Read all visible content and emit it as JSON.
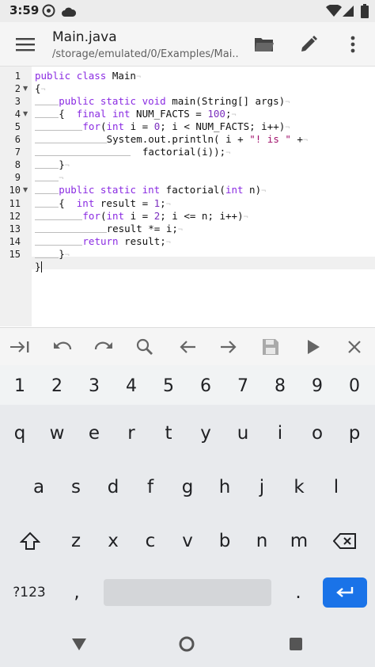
{
  "status_bar": {
    "time": "3:59"
  },
  "app_bar": {
    "title": "Main.java",
    "subtitle": "/storage/emulated/0/Examples/Mai..."
  },
  "editor": {
    "line_numbers": [
      "1",
      "2",
      "3",
      "4",
      "5",
      "6",
      "7",
      "8",
      "9",
      "10",
      "11",
      "12",
      "13",
      "14",
      "15"
    ],
    "folded_lines": [
      "2",
      "4",
      "10"
    ],
    "lines": [
      [
        {
          "t": "kw",
          "v": "public"
        },
        {
          "t": "p",
          "v": " "
        },
        {
          "t": "kw",
          "v": "class"
        },
        {
          "t": "p",
          "v": " Main"
        }
      ],
      [
        {
          "t": "p",
          "v": "{"
        }
      ],
      [
        {
          "t": "i",
          "n": 2
        },
        {
          "t": "kw",
          "v": "public"
        },
        {
          "t": "p",
          "v": " "
        },
        {
          "t": "kw",
          "v": "static"
        },
        {
          "t": "p",
          "v": " "
        },
        {
          "t": "kw",
          "v": "void"
        },
        {
          "t": "p",
          "v": " main(String[] args)"
        }
      ],
      [
        {
          "t": "i",
          "n": 2
        },
        {
          "t": "p",
          "v": "{"
        },
        {
          "t": "kw",
          "v": "  final"
        },
        {
          "t": "p",
          "v": " "
        },
        {
          "t": "kw",
          "v": "int"
        },
        {
          "t": "p",
          "v": " NUM_FACTS = "
        },
        {
          "t": "num",
          "v": "100"
        },
        {
          "t": "p",
          "v": ";"
        }
      ],
      [
        {
          "t": "i",
          "n": 4
        },
        {
          "t": "kw",
          "v": "for"
        },
        {
          "t": "p",
          "v": "("
        },
        {
          "t": "kw",
          "v": "int"
        },
        {
          "t": "p",
          "v": " i = "
        },
        {
          "t": "num",
          "v": "0"
        },
        {
          "t": "p",
          "v": "; i < NUM_FACTS; i++)"
        }
      ],
      [
        {
          "t": "i",
          "n": 6
        },
        {
          "t": "p",
          "v": "System.out.println( i + "
        },
        {
          "t": "str",
          "v": "\"! is \""
        },
        {
          "t": "p",
          "v": " +"
        }
      ],
      [
        {
          "t": "i",
          "n": 8
        },
        {
          "t": "p",
          "v": "  factorial(i));"
        }
      ],
      [
        {
          "t": "i",
          "n": 2
        },
        {
          "t": "p",
          "v": "}"
        }
      ],
      [
        {
          "t": "i",
          "n": 2
        }
      ],
      [
        {
          "t": "i",
          "n": 2
        },
        {
          "t": "kw",
          "v": "public"
        },
        {
          "t": "p",
          "v": " "
        },
        {
          "t": "kw",
          "v": "static"
        },
        {
          "t": "p",
          "v": " "
        },
        {
          "t": "kw",
          "v": "int"
        },
        {
          "t": "p",
          "v": " factorial("
        },
        {
          "t": "kw",
          "v": "int"
        },
        {
          "t": "p",
          "v": " n)"
        }
      ],
      [
        {
          "t": "i",
          "n": 2
        },
        {
          "t": "p",
          "v": "{"
        },
        {
          "t": "kw",
          "v": "  int"
        },
        {
          "t": "p",
          "v": " result = "
        },
        {
          "t": "num",
          "v": "1"
        },
        {
          "t": "p",
          "v": ";"
        }
      ],
      [
        {
          "t": "i",
          "n": 4
        },
        {
          "t": "kw",
          "v": "for"
        },
        {
          "t": "p",
          "v": "("
        },
        {
          "t": "kw",
          "v": "int"
        },
        {
          "t": "p",
          "v": " i = "
        },
        {
          "t": "num",
          "v": "2"
        },
        {
          "t": "p",
          "v": "; i <= n; i++)"
        }
      ],
      [
        {
          "t": "i",
          "n": 6
        },
        {
          "t": "p",
          "v": "result *= i;"
        }
      ],
      [
        {
          "t": "i",
          "n": 4
        },
        {
          "t": "kw",
          "v": "return"
        },
        {
          "t": "p",
          "v": " result;"
        }
      ],
      [
        {
          "t": "i",
          "n": 2
        },
        {
          "t": "p",
          "v": "}"
        }
      ],
      [
        {
          "t": "p",
          "v": "}"
        },
        {
          "t": "c"
        }
      ]
    ]
  },
  "toolbar": {
    "icons": [
      "tab-icon",
      "undo-icon",
      "redo-icon",
      "search-icon",
      "arrow-left-icon",
      "arrow-right-icon",
      "save-icon",
      "run-icon",
      "close-icon"
    ]
  },
  "keyboard": {
    "number_row": [
      "1",
      "2",
      "3",
      "4",
      "5",
      "6",
      "7",
      "8",
      "9",
      "0"
    ],
    "row1": [
      "q",
      "w",
      "e",
      "r",
      "t",
      "y",
      "u",
      "i",
      "o",
      "p"
    ],
    "row2": [
      "a",
      "s",
      "d",
      "f",
      "g",
      "h",
      "j",
      "k",
      "l"
    ],
    "row3": [
      "z",
      "x",
      "c",
      "v",
      "b",
      "n",
      "m"
    ],
    "symbols_label": "?123",
    "comma": ",",
    "period": "."
  },
  "colors": {
    "accent": "#1a73e8",
    "keyword": "#8a2be2",
    "string": "#a0106b"
  }
}
